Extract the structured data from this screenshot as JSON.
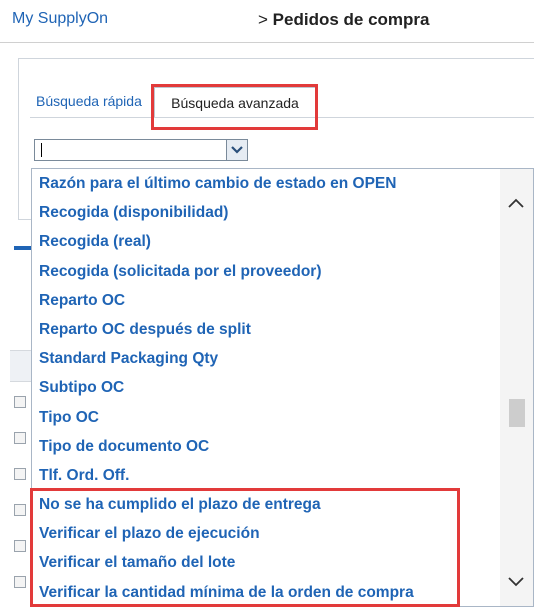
{
  "header": {
    "brand": "My SupplyOn",
    "breadcrumb_sep": ">",
    "breadcrumb_title": "Pedidos de compra"
  },
  "tabs": [
    {
      "label": "Búsqueda rápida",
      "active": false
    },
    {
      "label": "Búsqueda avanzada",
      "active": true
    }
  ],
  "field_dropdown": {
    "value": "",
    "options": [
      "Razón para el último cambio de estado en OPEN",
      "Recogida (disponibilidad)",
      "Recogida (real)",
      "Recogida (solicitada por el proveedor)",
      "Reparto OC",
      "Reparto OC después de split",
      "Standard Packaging Qty",
      "Subtipo OC",
      "Tipo OC",
      "Tipo de documento OC",
      "Tlf. Ord. Off.",
      "No se ha cumplido el plazo de entrega",
      "Verificar el plazo de ejecución",
      "Verificar el tamaño del lote",
      "Verificar la cantidad mínima de la orden de compra"
    ]
  },
  "colors": {
    "link_blue": "#1f64b5",
    "highlight_red": "#e23a3a"
  }
}
